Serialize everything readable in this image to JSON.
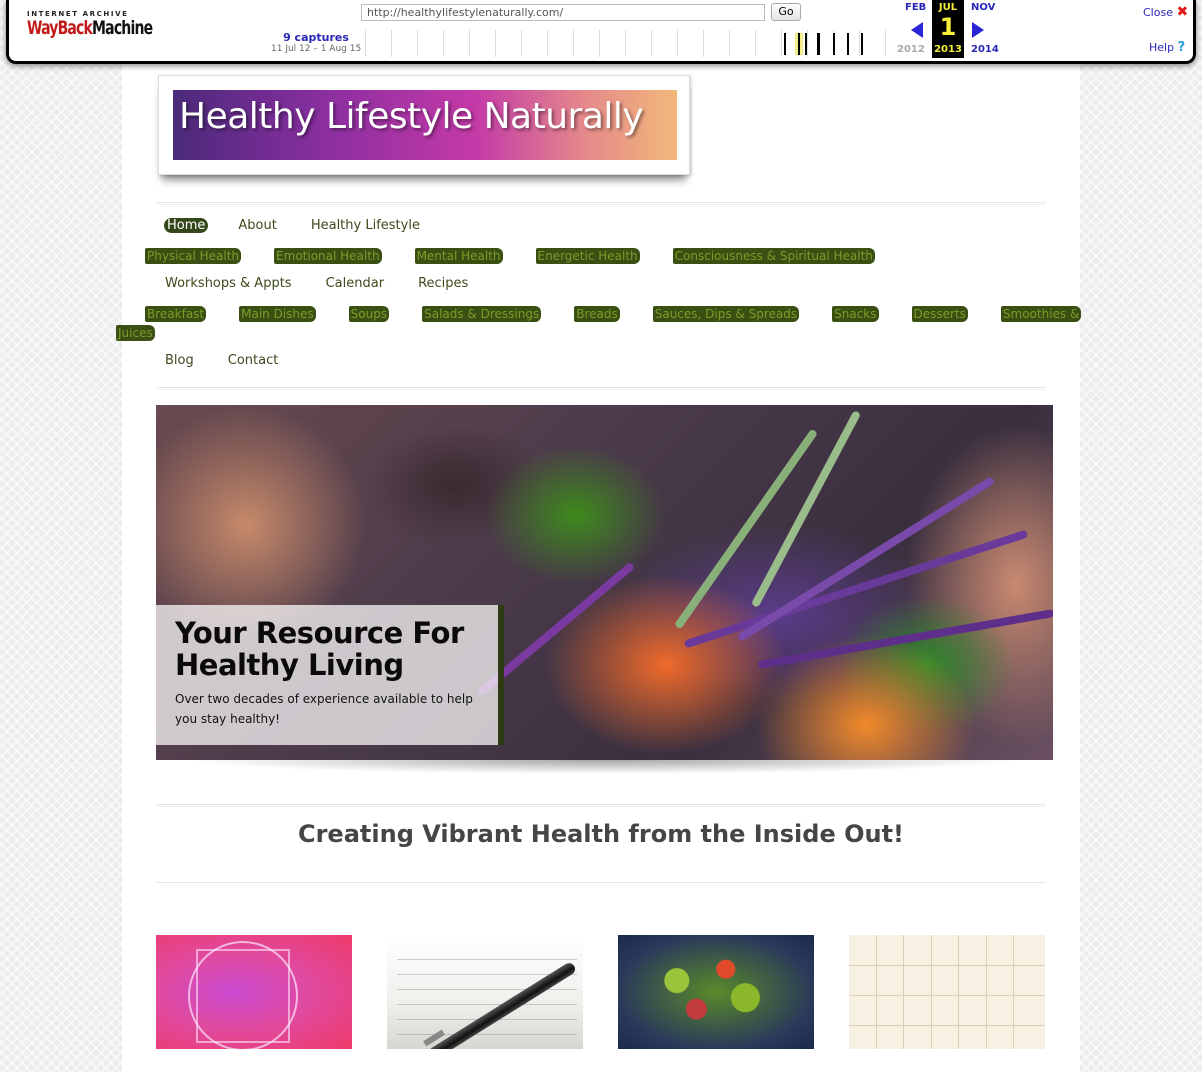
{
  "wayback": {
    "logo_top": "INTERNET ARCHIVE",
    "logo_main_a": "WayBack",
    "logo_main_b": "Machine",
    "url": "http://healthylifestylenaturally.com/",
    "go_label": "Go",
    "captures_count": "9 captures",
    "captures_range": "11 Jul 12 – 1 Aug 15",
    "prev_month": "FEB",
    "prev_year": "2012",
    "current_month": "JUL",
    "current_day": "1",
    "current_year": "2013",
    "next_month": "NOV",
    "next_year": "2014",
    "close_label": "Close",
    "help_label": "Help",
    "colors": {
      "link": "#2a26b8",
      "highlight": "#f4ef3a",
      "close_x": "#e01a1a"
    }
  },
  "site": {
    "title": "Healthy Lifestyle Naturally",
    "nav": {
      "row1": [
        "Home",
        "About",
        "Healthy Lifestyle"
      ],
      "row2": [
        "Physical Health",
        "Emotional Health",
        "Mental Health",
        "Energetic Health",
        "Consciousness & Spiritual Health"
      ],
      "row3": [
        "Workshops & Appts",
        "Calendar",
        "Recipes"
      ],
      "row4": [
        "Breakfast",
        "Main Dishes",
        "Soups",
        "Salads & Dressings",
        "Breads",
        "Sauces, Dips & Spreads",
        "Snacks",
        "Desserts",
        "Smoothies &"
      ],
      "row4_wrap": "Juices",
      "row5": [
        "Blog",
        "Contact"
      ]
    },
    "hero": {
      "title": "Your Resource For Healthy Living",
      "subtitle": "Over two decades of experience available to help you stay healthy!"
    },
    "tagline": "Creating Vibrant Health from the Inside Out!",
    "colors": {
      "nav_text": "#3c4a1c",
      "nav_highlight_bg": "#3a4f12",
      "nav_highlight_text": "#7e9a2a",
      "tagline": "#454545"
    }
  }
}
